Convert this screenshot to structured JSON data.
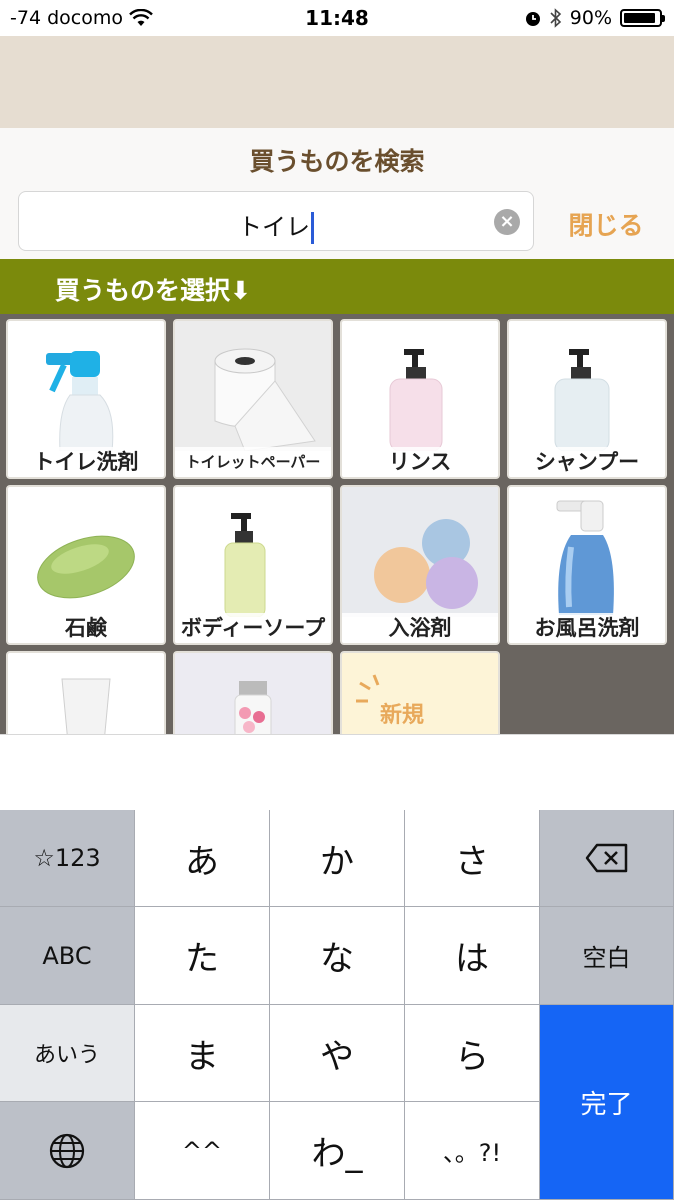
{
  "status_bar": {
    "carrier": "-74 docomo",
    "time": "11:48",
    "battery": "90%",
    "battery_level": 0.9
  },
  "search": {
    "title": "買うものを検索",
    "value": "トイレ",
    "close_label": "閉じる"
  },
  "section": {
    "label": "買うものを選択⬇"
  },
  "items": [
    {
      "name": "トイレ洗剤",
      "icon": "spray-bottle-icon"
    },
    {
      "name": "トイレットペーパー",
      "icon": "toilet-paper-icon"
    },
    {
      "name": "リンス",
      "icon": "pump-bottle-icon"
    },
    {
      "name": "シャンプー",
      "icon": "pump-bottle-icon"
    },
    {
      "name": "石鹸",
      "icon": "soap-bar-icon"
    },
    {
      "name": "ボディーソープ",
      "icon": "pump-bottle-icon"
    },
    {
      "name": "入浴剤",
      "icon": "bath-bomb-icon"
    },
    {
      "name": "お風呂洗剤",
      "icon": "spray-bottle-icon"
    },
    {
      "name": "",
      "icon": "tube-icon"
    },
    {
      "name": "",
      "icon": "bottle-icon"
    }
  ],
  "new_item": {
    "label": "新規"
  },
  "keyboard": {
    "symbols": "☆123",
    "abc": "ABC",
    "kana_mode": "あいう",
    "k1": "あ",
    "k2": "か",
    "k3": "さ",
    "k4": "た",
    "k5": "な",
    "k6": "は",
    "k7": "ま",
    "k8": "や",
    "k9": "ら",
    "k10": "^^",
    "k11": "わ_",
    "k12": "、。?!",
    "space": "空白",
    "done": "完了"
  },
  "colors": {
    "accent_green": "#7b8a0c",
    "title_brown": "#6a4f2e",
    "close_orange": "#e6a452",
    "done_blue": "#1565f5"
  }
}
